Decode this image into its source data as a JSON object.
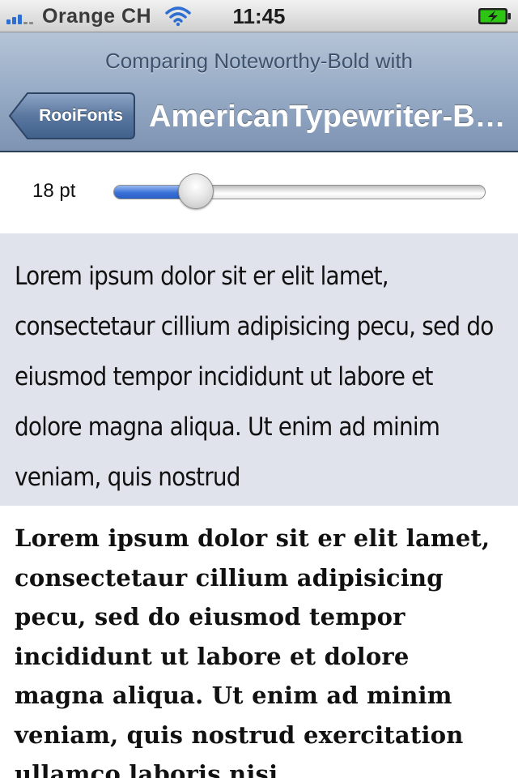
{
  "status_bar": {
    "carrier": "Orange CH",
    "time": "11:45",
    "signal_bars": 3,
    "signal_icon": "signal-bars-icon",
    "wifi_icon": "wifi-icon",
    "battery_icon": "battery-charging-icon",
    "battery_level": 1.0
  },
  "nav": {
    "prompt": "Comparing Noteworthy-Bold with",
    "back_label": "RooiFonts",
    "title": "AmericanTypewriter-Bold"
  },
  "size_control": {
    "label": "18 pt",
    "slider_fraction": 0.22
  },
  "samples": {
    "first": "Lorem ipsum dolor sit er elit lamet, consectetaur cillium adipisicing pecu, sed do eiusmod tempor incididunt ut labore et dolore magna aliqua. Ut enim ad minim veniam, quis nostrud",
    "second": "Lorem ipsum dolor sit er elit lamet, consectetaur cillium adipisicing pecu, sed do eiusmod tempor incididunt ut labore et dolore magna aliqua. Ut enim ad minim veniam, quis nostrud exercitation ullamco laboris nisi"
  },
  "colors": {
    "slider_fill": "#3a72d8",
    "battery_fill": "#2ec414",
    "nav_title": "#ffffff"
  }
}
